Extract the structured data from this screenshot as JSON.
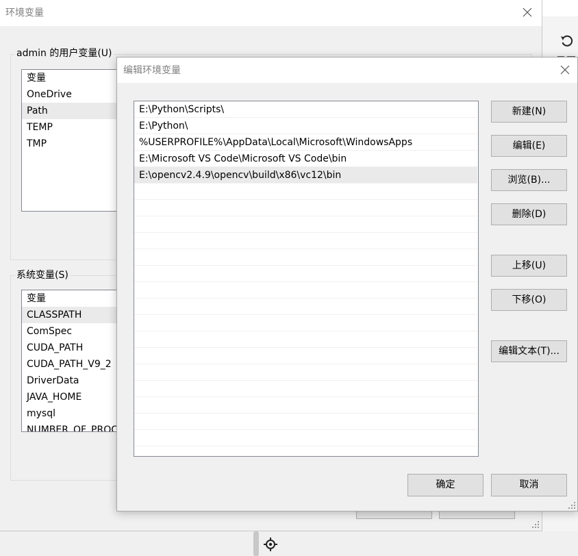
{
  "parent_dialog": {
    "title": "环境变量",
    "user_vars": {
      "group_label": "admin 的用户变量(U)",
      "header": "变量",
      "rows": [
        "OneDrive",
        "Path",
        "TEMP",
        "TMP"
      ]
    },
    "system_vars": {
      "group_label": "系统变量(S)",
      "header": "变量",
      "rows": [
        "CLASSPATH",
        "ComSpec",
        "CUDA_PATH",
        "CUDA_PATH_V9_2",
        "DriverData",
        "JAVA_HOME",
        "mysql",
        "NUMBER_OF_PROCESSORS"
      ]
    }
  },
  "edit_dialog": {
    "title": "编辑环境变量",
    "paths": [
      "E:\\Python\\Scripts\\",
      "E:\\Python\\",
      "%USERPROFILE%\\AppData\\Local\\Microsoft\\WindowsApps",
      "E:\\Microsoft VS Code\\Microsoft VS Code\\bin",
      "E:\\opencv2.4.9\\opencv\\build\\x86\\vc12\\bin"
    ],
    "selected_index": 4,
    "buttons": {
      "new": "新建(N)",
      "edit": "编辑(E)",
      "browse": "浏览(B)...",
      "delete": "删除(D)",
      "move_up": "上移(U)",
      "move_down": "下移(O)",
      "edit_text": "编辑文本(T)..."
    },
    "footer": {
      "ok": "确定",
      "cancel": "取消"
    }
  },
  "icons": {
    "parent_close": "close-icon",
    "child_close": "close-icon",
    "background_undo": "undo-icon",
    "bottom": "crosshair-icon",
    "resize": "resize-grip-icon"
  }
}
